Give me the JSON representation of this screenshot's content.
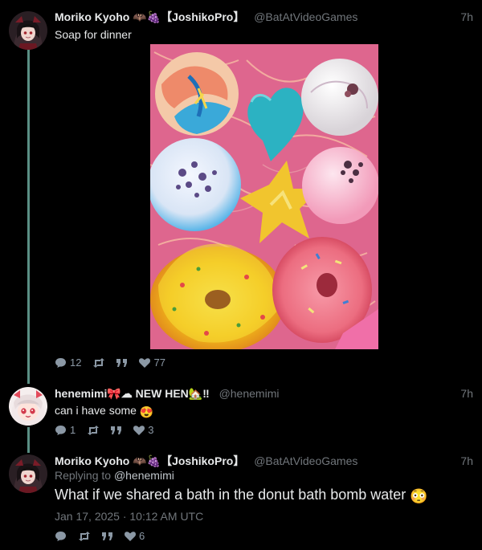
{
  "tweets": [
    {
      "display_name": "Moriko Kyoho 🦇🍇【JoshikoPro】",
      "handle": "@BatAtVideoGames",
      "time": "7h",
      "text": "Soap for dinner",
      "has_image": true,
      "stats": {
        "replies": "12",
        "likes": "77"
      }
    },
    {
      "display_name": "henemimi🎀☁ NEW HEN🏡‼",
      "handle": "@henemimi",
      "time": "7h",
      "text": "can i have some",
      "text_emoji": "😍",
      "stats": {
        "replies": "1",
        "likes": "3"
      }
    },
    {
      "display_name": "Moriko Kyoho 🦇🍇【JoshikoPro】",
      "handle": "@BatAtVideoGames",
      "time": "7h",
      "replying_prefix": "Replying to",
      "replying_handle": "@henemimi",
      "text": "What if we shared a bath in the donut bath bomb water",
      "text_emoji": "😳",
      "timestamp": "Jan 17, 2025 · 10:12 AM UTC",
      "stats": {
        "likes": "6"
      }
    }
  ],
  "colors": {
    "thread_line": "#5a8f84",
    "muted": "#71767b",
    "background": "#000000"
  },
  "icons": [
    "reply-icon",
    "retweet-icon",
    "quote-icon",
    "heart-icon"
  ]
}
